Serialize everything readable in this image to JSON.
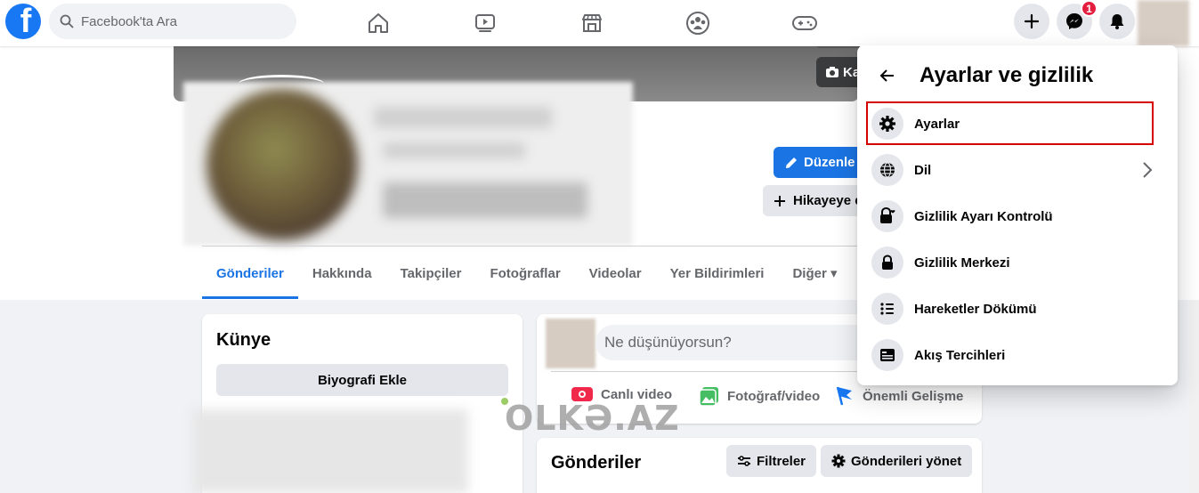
{
  "topbar": {
    "search_placeholder": "Facebook'ta Ara",
    "messenger_badge": "1",
    "nav_icons": [
      "home-icon",
      "watch-icon",
      "marketplace-icon",
      "groups-icon",
      "gaming-icon"
    ]
  },
  "cover": {
    "camera_button_label": "Ka"
  },
  "profile": {
    "edit_button_label": "Düzenle",
    "story_button_label": "Hikayeye e"
  },
  "tabs": [
    {
      "label": "Gönderiler",
      "active": true
    },
    {
      "label": "Hakkında"
    },
    {
      "label": "Takipçiler"
    },
    {
      "label": "Fotoğraflar"
    },
    {
      "label": "Videolar"
    },
    {
      "label": "Yer Bildirimleri"
    },
    {
      "label": "Diğer ▾"
    }
  ],
  "intro": {
    "title": "Künye",
    "bio_button_label": "Biyografi Ekle"
  },
  "composer": {
    "placeholder": "Ne düşünüyorsun?",
    "actions": [
      "Canlı video",
      "Fotoğraf/video",
      "Önemli Gelişme"
    ]
  },
  "posts": {
    "title": "Gönderiler",
    "filter_label": "Filtreler",
    "manage_label": "Gönderileri yönet"
  },
  "menu": {
    "title": "Ayarlar ve gizlilik",
    "items": [
      {
        "label": "Ayarlar",
        "icon": "gear-icon"
      },
      {
        "label": "Dil",
        "icon": "globe-icon"
      },
      {
        "label": "Gizlilik Ayarı Kontrolü",
        "icon": "lock-heart-icon"
      },
      {
        "label": "Gizlilik Merkezi",
        "icon": "lock-icon"
      },
      {
        "label": "Hareketler Dökümü",
        "icon": "list-icon"
      },
      {
        "label": "Akış Tercihleri",
        "icon": "feed-icon"
      }
    ]
  },
  "watermark": "OLKƏ.AZ",
  "colors": {
    "brand": "#1877f2",
    "accent": "#1b74e4",
    "badge": "#e41e3f",
    "highlight_box": "#d50000"
  }
}
